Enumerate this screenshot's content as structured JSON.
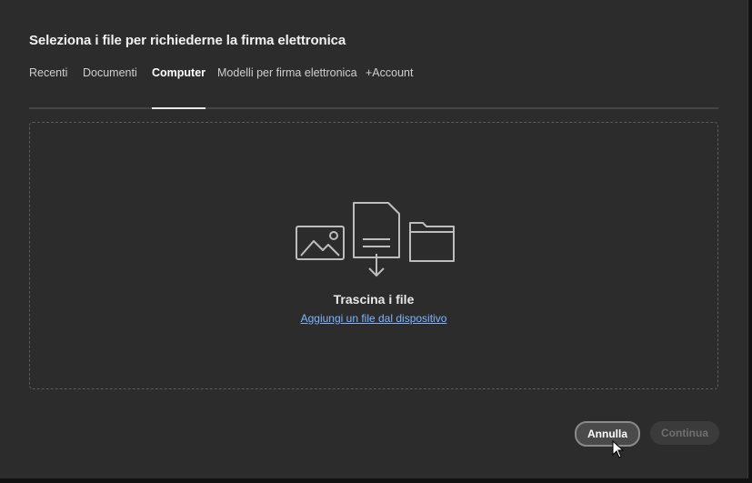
{
  "dialog": {
    "title": "Seleziona i file per richiederne la firma elettronica"
  },
  "tabs": [
    {
      "label": "Recenti",
      "active": false
    },
    {
      "label": "Documenti",
      "active": false
    },
    {
      "label": "Computer",
      "active": true
    },
    {
      "label": "Modelli per firma elettronica",
      "active": false
    },
    {
      "label": "+Account",
      "active": false
    }
  ],
  "dropzone": {
    "title": "Trascina i file",
    "link": "Aggiungi un file dal dispositivo",
    "icons": [
      "image-icon",
      "document-download-icon",
      "folder-icon"
    ]
  },
  "buttons": {
    "cancel": "Annulla",
    "continue": "Continua"
  },
  "colors": {
    "background": "#2c2c2c",
    "link": "#7fb4ff",
    "active_tab_underline": "#e8e8e8"
  }
}
